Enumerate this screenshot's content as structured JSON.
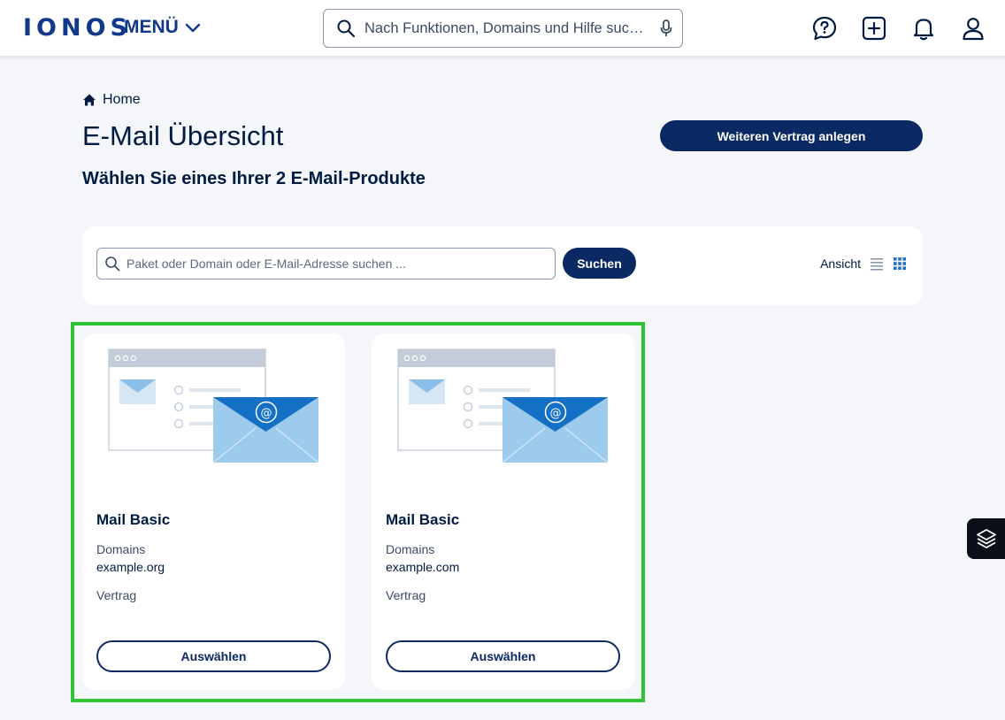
{
  "header": {
    "logo_text": "IONOS",
    "menu_label": "MENÜ",
    "search_placeholder": "Nach Funktionen, Domains und Hilfe suc…",
    "icons": [
      "help-chat-icon",
      "add-icon",
      "bell-icon",
      "user-icon"
    ]
  },
  "breadcrumb": {
    "label": "Home"
  },
  "page": {
    "title": "E-Mail Übersicht",
    "subtitle": "Wählen Sie eines Ihrer 2 E-Mail-Produkte",
    "primary_button": "Weiteren Vertrag anlegen"
  },
  "filter": {
    "placeholder": "Paket oder Domain oder E-Mail-Adresse suchen ...",
    "search_button": "Suchen",
    "view_label": "Ansicht",
    "active_view": "grid"
  },
  "cards": [
    {
      "title": "Mail Basic",
      "domains_label": "Domains",
      "domain": "example.org",
      "contract_label": "Vertrag",
      "button": "Auswählen"
    },
    {
      "title": "Mail Basic",
      "domains_label": "Domains",
      "domain": "example.com",
      "contract_label": "Vertrag",
      "button": "Auswählen"
    }
  ],
  "colors": {
    "brand": "#11388a",
    "primary_button": "#0b2a63",
    "highlight": "#2fc335",
    "background": "#f4f6f9"
  }
}
